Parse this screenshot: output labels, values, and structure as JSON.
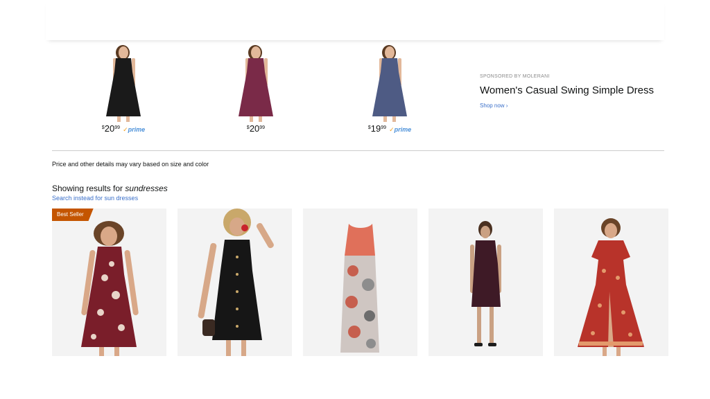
{
  "sponsored": {
    "products": [
      {
        "dress_color": "#1a1a1a",
        "price": {
          "symbol": "$",
          "whole": "20",
          "fraction": "99"
        },
        "prime": "prime"
      },
      {
        "dress_color": "#7a2a48",
        "price": {
          "symbol": "$",
          "whole": "20",
          "fraction": "99"
        },
        "prime": ""
      },
      {
        "dress_color": "#4e5b84",
        "price": {
          "symbol": "$",
          "whole": "19",
          "fraction": "99"
        },
        "prime": "prime"
      }
    ],
    "sponsored_by": "SPONSORED BY MOLERANI",
    "title": "Women's Casual Swing Simple Dress",
    "shop_now": "Shop now ›"
  },
  "disclaimer": "Price and other details may vary based on size and color",
  "results": {
    "showing_prefix": "Showing results for ",
    "query": "sundresses",
    "search_instead": "Search instead for sun dresses"
  },
  "grid": [
    {
      "badge": "Best Seller",
      "dress_color": "#7a1e2a",
      "pattern_color": "#e8d4c8"
    },
    {
      "badge": "",
      "dress_color": "#161616",
      "pattern_color": "#c9a86a"
    },
    {
      "badge": "",
      "dress_color": "#e0705a",
      "pattern_color": "#cfc6c2"
    },
    {
      "badge": "",
      "dress_color": "#3e1a26",
      "pattern_color": "#3e1a26"
    },
    {
      "badge": "",
      "dress_color": "#b8332a",
      "pattern_color": "#e39a6c"
    }
  ],
  "colors": {
    "link": "#3a6fc9",
    "badge": "#c45500",
    "prime_check": "#f0a020",
    "prime_text": "#4a90d9"
  }
}
